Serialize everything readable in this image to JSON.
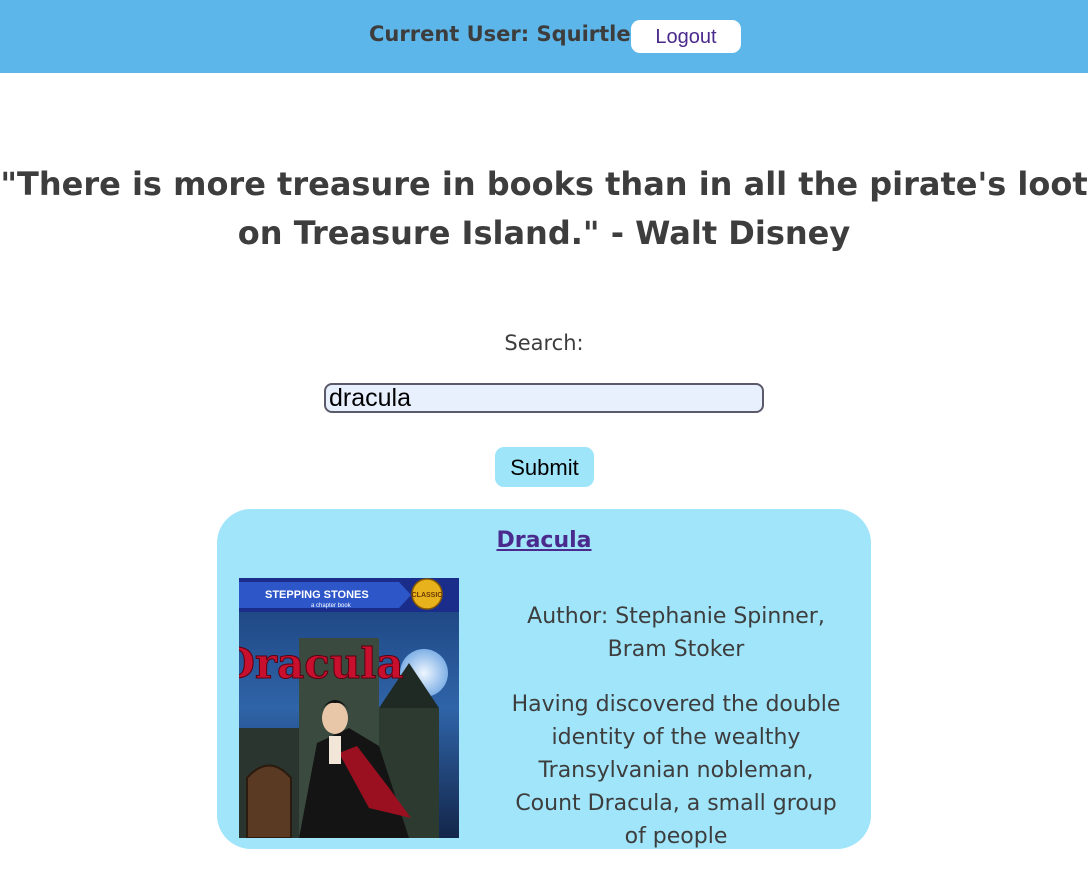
{
  "header": {
    "current_user": "Current User: Squirtle",
    "logout_label": "Logout"
  },
  "quote": {
    "text": "\"There is more treasure in books than in all the pirate's loot on Treasure Island.\" - Walt Disney"
  },
  "search": {
    "label": "Search:",
    "value": "dracula",
    "submit_label": "Submit"
  },
  "results": [
    {
      "title": "Dracula",
      "author": "Author: Stephanie Spinner, Bram Stoker",
      "description": "Having discovered the double identity of the wealthy Transylvanian nobleman, Count Dracula, a small group of people",
      "cover": {
        "series": "STEPPING STONES",
        "subtitle": "a chapter book",
        "badge": "CLASSIC",
        "title": "Dracula"
      }
    }
  ],
  "colors": {
    "topbar": "#5db6e9",
    "card": "#a0e5fa",
    "link": "#4a2a8c",
    "text": "#3d3d3d"
  }
}
